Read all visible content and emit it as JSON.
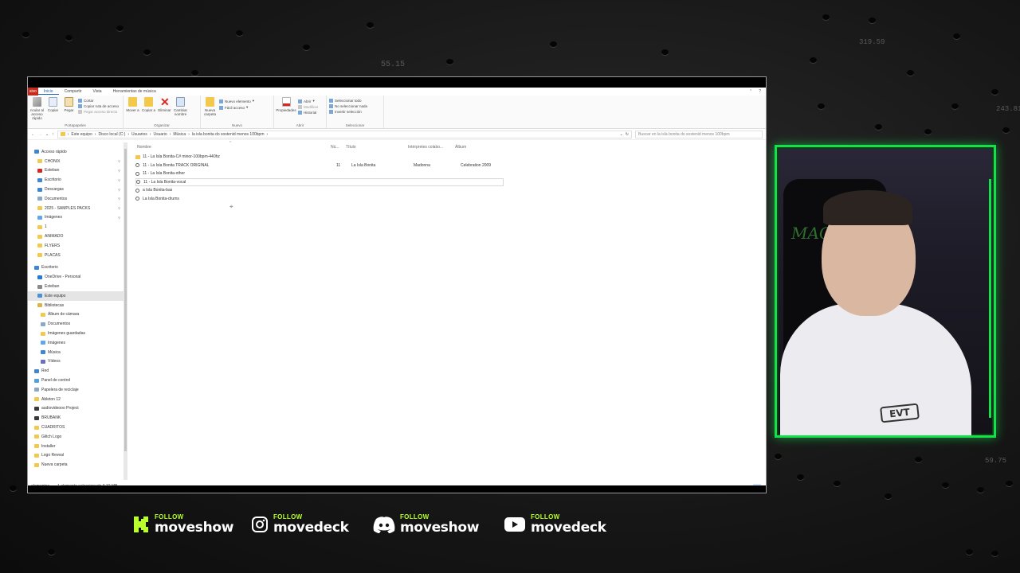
{
  "background": {
    "numbers": [
      "55.15",
      "319.59",
      "243.81",
      "59.75"
    ]
  },
  "explorer": {
    "menu": {
      "file_tab": "sivo",
      "tabs": [
        "Inicio",
        "Compartir",
        "Vista",
        "Herramientas de música"
      ]
    },
    "ribbon": {
      "portapapeles": {
        "label": "Portapapeles",
        "anclar": "ncular al acceso rápido",
        "copiar": "Copiar",
        "pegar": "Pegar",
        "cortar": "Cortar",
        "copiar_ruta": "Copiar ruta de acceso",
        "pegar_acceso": "Pegar acceso directo"
      },
      "organizar": {
        "label": "Organizar",
        "mover": "Mover a",
        "copiar": "Copiar a",
        "eliminar": "Eliminar",
        "cambiar": "Cambiar nombre"
      },
      "nuevo": {
        "label": "Nuevo",
        "carpeta": "Nueva carpeta",
        "elemento": "Nuevo elemento",
        "facil": "Fácil acceso"
      },
      "abrir": {
        "label": "Abrir",
        "propiedades": "Propiedades",
        "abrir": "Abrir",
        "modificar": "Modificar",
        "historial": "Historial"
      },
      "seleccionar": {
        "label": "Seleccionar",
        "todo": "Seleccionar todo",
        "nada": "No seleccionar nada",
        "invertir": "Invertir selección"
      }
    },
    "address": {
      "crumbs": [
        "Este equipo",
        "Disco local (C:)",
        "Usuarios",
        "Usuario",
        "Música",
        "la isla bonita do sostenid menos 100bpm"
      ],
      "search_placeholder": "Buscar en la isla bonita do sostenid menos 100bpm"
    },
    "nav": [
      {
        "label": "Acceso rápido",
        "icon": "star-icon",
        "level": 0
      },
      {
        "label": "CHONIX",
        "icon": "folder-icon",
        "level": 1,
        "pinned": true
      },
      {
        "label": "Esteban",
        "icon": "user-folder-icon",
        "level": 1,
        "pinned": true
      },
      {
        "label": "Escritorio",
        "icon": "desktop-icon",
        "level": 1,
        "pinned": true
      },
      {
        "label": "Descargas",
        "icon": "download-icon",
        "level": 1,
        "pinned": true
      },
      {
        "label": "Documentos",
        "icon": "documents-icon",
        "level": 1,
        "pinned": true
      },
      {
        "label": "2025 - SAMPLES PACKS",
        "icon": "folder-icon",
        "level": 1,
        "pinned": true
      },
      {
        "label": "Imágenes",
        "icon": "pictures-icon",
        "level": 1,
        "pinned": true
      },
      {
        "label": "1",
        "icon": "folder-icon",
        "level": 1
      },
      {
        "label": "ANIMADO",
        "icon": "folder-icon",
        "level": 1
      },
      {
        "label": "FLYERS",
        "icon": "folder-icon",
        "level": 1
      },
      {
        "label": "PLACAS",
        "icon": "folder-icon",
        "level": 1
      },
      {
        "label": "Escritorio",
        "icon": "desktop-icon",
        "level": 0,
        "gap": true
      },
      {
        "label": "OneDrive - Personal",
        "icon": "cloud-icon",
        "level": 1
      },
      {
        "label": "Esteban",
        "icon": "user-icon",
        "level": 1
      },
      {
        "label": "Este equipo",
        "icon": "computer-icon",
        "level": 1,
        "selected": true
      },
      {
        "label": "Bibliotecas",
        "icon": "libraries-icon",
        "level": 1
      },
      {
        "label": "Álbum de cámara",
        "icon": "folder-icon",
        "level": 2
      },
      {
        "label": "Documentos",
        "icon": "documents-icon",
        "level": 2
      },
      {
        "label": "Imágenes guardadas",
        "icon": "folder-icon",
        "level": 2
      },
      {
        "label": "Imágenes",
        "icon": "pictures-icon",
        "level": 2
      },
      {
        "label": "Música",
        "icon": "music-icon",
        "level": 2
      },
      {
        "label": "Vídeos",
        "icon": "video-icon",
        "level": 2
      },
      {
        "label": "Red",
        "icon": "network-icon",
        "level": 0
      },
      {
        "label": "Panel de control",
        "icon": "control-panel-icon",
        "level": 0
      },
      {
        "label": "Papelera de reciclaje",
        "icon": "recycle-bin-icon",
        "level": 0
      },
      {
        "label": "Ableton 12",
        "icon": "folder-icon",
        "level": 0
      },
      {
        "label": "audiovideooo Project",
        "icon": "folder-dark-icon",
        "level": 0
      },
      {
        "label": "BRUBANK",
        "icon": "folder-dark-icon",
        "level": 0
      },
      {
        "label": "CUADRITOS",
        "icon": "folder-icon",
        "level": 0
      },
      {
        "label": "Glitch Logo",
        "icon": "folder-icon",
        "level": 0
      },
      {
        "label": "Installer",
        "icon": "folder-icon",
        "level": 0
      },
      {
        "label": "Logo Reveal",
        "icon": "folder-icon",
        "level": 0
      },
      {
        "label": "Nueva carpeta",
        "icon": "folder-icon",
        "level": 0
      }
    ],
    "columns": {
      "name": "Nombre",
      "num": "Nú...",
      "title": "Título",
      "artists": "Intérpretes colabo...",
      "album": "Álbum"
    },
    "files": [
      {
        "name": "11 - La Isla Bonita-C# minor-100bpm-440hz",
        "icon": "folder-icon",
        "num": "",
        "title": "",
        "artists": "",
        "album": ""
      },
      {
        "name": "11 - La Isla Bonita TRACK ORIGINAL",
        "icon": "audio-file-icon",
        "num": "11",
        "title": "La Isla Bonita",
        "artists": "Madonna",
        "album": "Celebration 2009"
      },
      {
        "name": "11 - La Isla Bonita-other",
        "icon": "audio-file-icon",
        "num": "",
        "title": "",
        "artists": "",
        "album": ""
      },
      {
        "name": "11 - La Isla Bonita-vocal",
        "icon": "audio-file-icon",
        "num": "",
        "title": "",
        "artists": "",
        "album": "",
        "selected": true
      },
      {
        "name": "a Isla Bonita-bas",
        "icon": "audio-file-icon",
        "num": "",
        "title": "",
        "artists": "",
        "album": ""
      },
      {
        "name": "La Isla Bonita-drums",
        "icon": "audio-file-icon",
        "num": "",
        "title": "",
        "artists": "",
        "album": ""
      }
    ],
    "status": {
      "count": "elementos",
      "selection": "1 elemento seleccionado  9,32 MB"
    }
  },
  "webcam": {
    "backdrop_text": "MAG",
    "shirt_logo": "EVT"
  },
  "follow": [
    {
      "small": "FOLLOW",
      "handle": "moveshow",
      "icon": "kick-icon",
      "color": "#b8ff2c"
    },
    {
      "small": "FOLLOW",
      "handle": "movedeck",
      "icon": "instagram-icon",
      "color": "#ffffff"
    },
    {
      "small": "FOLLOW",
      "handle": "moveshow",
      "icon": "discord-icon",
      "color": "#ffffff"
    },
    {
      "small": "FOLLOW",
      "handle": "movedeck",
      "icon": "youtube-icon",
      "color": "#ffffff"
    }
  ],
  "colors": {
    "accent_green": "#13e04a",
    "follow_green": "#b8ff2c",
    "delete_red": "#d9261c",
    "explorer_blue": "#1a5fb4"
  }
}
